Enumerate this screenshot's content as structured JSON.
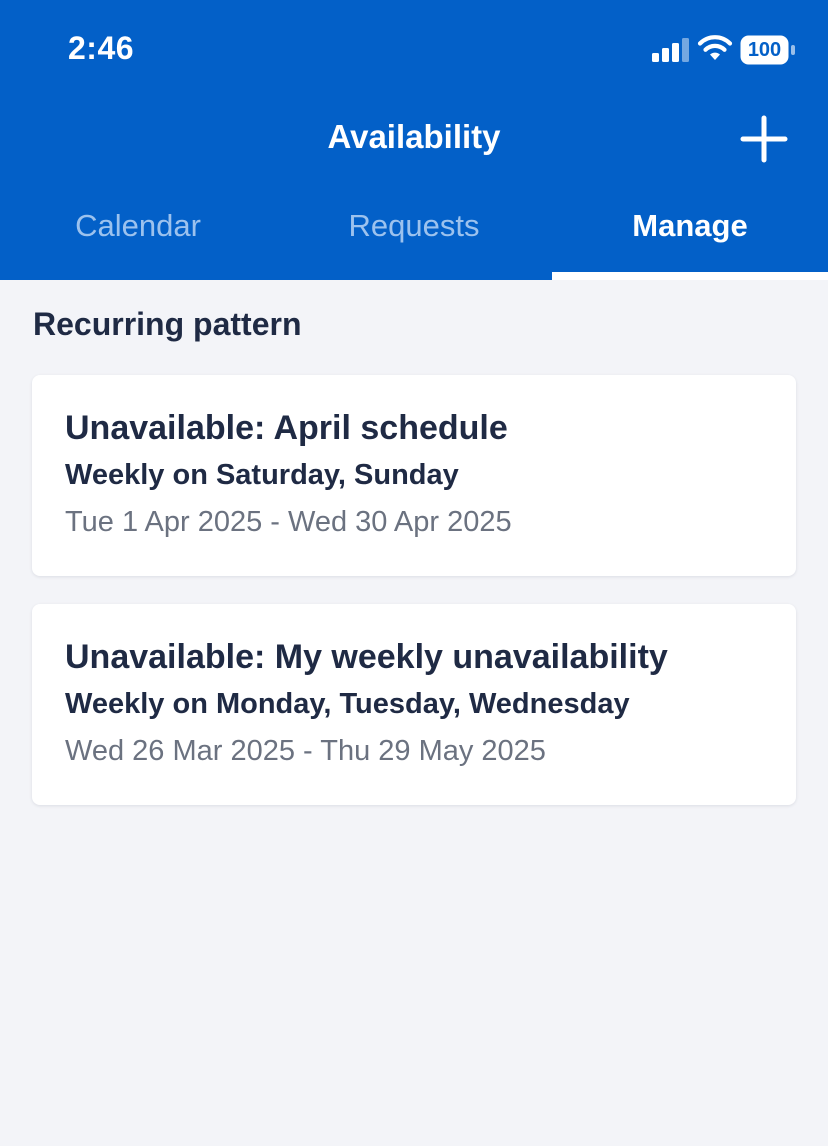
{
  "status_bar": {
    "time": "2:46",
    "battery_level": "100",
    "icons": [
      "signal-icon",
      "wifi-icon",
      "battery-icon"
    ]
  },
  "header": {
    "title": "Availability",
    "add_icon": "plus-icon",
    "background_color": "#0360c8"
  },
  "tabs": [
    {
      "label": "Calendar",
      "active": false
    },
    {
      "label": "Requests",
      "active": false
    },
    {
      "label": "Manage",
      "active": true
    }
  ],
  "section": {
    "title": "Recurring pattern"
  },
  "patterns": [
    {
      "title": "Unavailable: April schedule",
      "recurrence": "Weekly on Saturday, Sunday",
      "dates": "Tue 1 Apr 2025 - Wed 30 Apr 2025"
    },
    {
      "title": "Unavailable: My weekly unavailability",
      "recurrence": "Weekly on Monday, Tuesday, Wednesday",
      "dates": "Wed 26 Mar 2025 - Thu 29 May 2025"
    }
  ]
}
